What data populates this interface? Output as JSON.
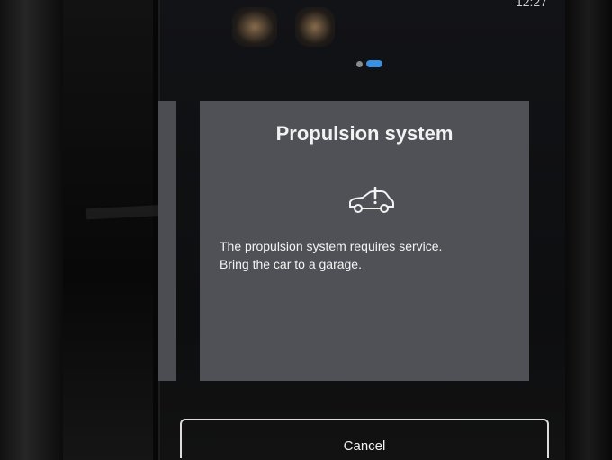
{
  "status_bar": {
    "time": "12:27"
  },
  "pager": {
    "page_count": 2,
    "active_index": 1,
    "active_color": "#3d8fe0"
  },
  "dialog": {
    "title": "Propulsion system",
    "icon": "car-warning-icon",
    "message_line1": "The propulsion system requires service.",
    "message_line2": "Bring the car to a garage."
  },
  "actions": {
    "cancel_label": "Cancel"
  },
  "colors": {
    "card_background": "#4f5156",
    "screen_background": "#0d0e10",
    "text": "#f2f2f2"
  }
}
